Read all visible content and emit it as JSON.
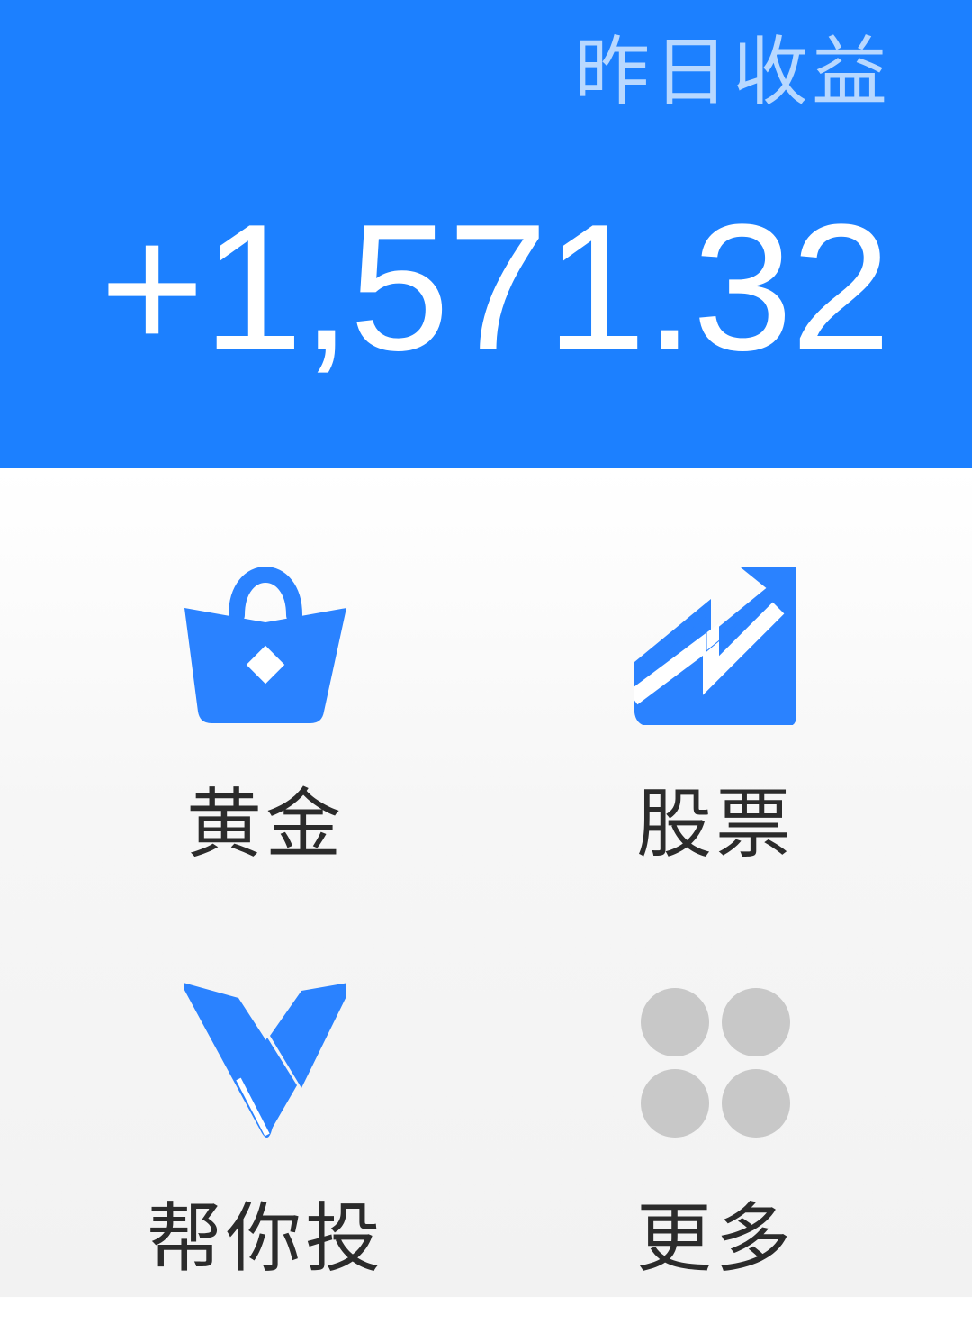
{
  "header": {
    "title": "昨日收益",
    "amount": "+1,571.32"
  },
  "colors": {
    "primary": "#1c80ff",
    "icon_blue": "#2a82ff",
    "more_icon_gray": "#c8c8c8",
    "label_text": "#2b2b2b"
  },
  "grid": {
    "items": [
      {
        "label": "黄金",
        "icon": "shopping-bag-icon"
      },
      {
        "label": "股票",
        "icon": "trend-chart-icon"
      },
      {
        "label": "帮你投",
        "icon": "v-logo-icon"
      },
      {
        "label": "更多",
        "icon": "more-dots-icon"
      }
    ]
  }
}
